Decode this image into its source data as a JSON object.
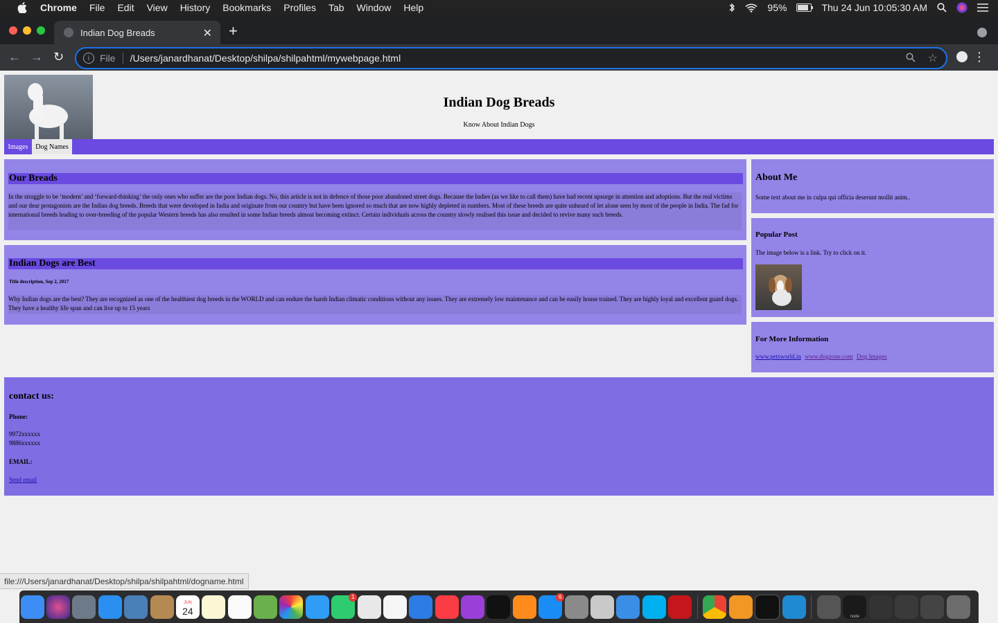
{
  "menubar": {
    "app": "Chrome",
    "items": [
      "File",
      "Edit",
      "View",
      "History",
      "Bookmarks",
      "Profiles",
      "Tab",
      "Window",
      "Help"
    ],
    "battery": "95%",
    "battery_level": 0.95,
    "clock": "Thu 24 Jun  10:05:30 AM"
  },
  "browser": {
    "tab_title": "Indian Dog Breads",
    "scheme": "File",
    "url": "/Users/janardhanat/Desktop/shilpa/shilpahtml/mywebpage.html",
    "status_url": "file:///Users/janardhanat/Desktop/shilpa/shilpahtml/dogname.html"
  },
  "page": {
    "title": "Indian Dog Breads",
    "tagline": "Know About Indian Dogs",
    "nav": [
      "Images",
      "Dog Names"
    ],
    "section1": {
      "title": "Our Breads",
      "body": "In the struggle to be ‘modern’ and ‘forward-thinking’ the only ones who suffer are the poor Indian dogs. No, this article is not in defence of those poor abandoned street dogs. Because the Indies (as we like to call them) have had recent upsurge in attention and adoptions. But the real victims and our dear protagonists are the Indian dog breeds. Breeds that were developed in India and originate from our country but have been ignored so much that are now highly depleted in numbers. Most of these breeds are quite unheard of let alone seen by most of the people in India. The fad for international breeds leading to over-breeding of the popular Western breeds has also resulted in some Indian breeds almost becoming extinct. Certain individuals across the country slowly realised this issue and decided to revive many such breeds."
    },
    "section2": {
      "title": "Indian Dogs are Best",
      "meta": "Title description, Sep 2, 2017",
      "body": "Why Indian dogs are the best? They are recognized as one of the healthiest dog breeds in the WORLD and can endure the harsh Indian climatic conditions without any issues. They are extremely low maintenance and can be easily house trained. They are highly loyal and excellent guard dogs. They have a healthy life span and can live up to 15 years"
    },
    "about": {
      "title": "About Me",
      "text": "Some text about me in culpa qui officia deserunt mollit anim.."
    },
    "popular": {
      "title": "Popular Post",
      "text": "The image below is a link. Try to click on it."
    },
    "more": {
      "title": "For More Information",
      "links": [
        "www.petsworld.in",
        "www.dogzone.com",
        "Dog Images"
      ]
    },
    "contact": {
      "title": "contact us:",
      "phone_label": "Phone:",
      "phones": [
        "9972xxxxxx",
        "9886xxxxxx"
      ],
      "email_label": "EMAIL:",
      "email_link": "Send email"
    }
  },
  "dock": {
    "badges": {
      "facetime": "1",
      "appstore": "6"
    },
    "calendar_day": "24",
    "calendar_month": "JUN",
    "terminal_label": "node"
  }
}
